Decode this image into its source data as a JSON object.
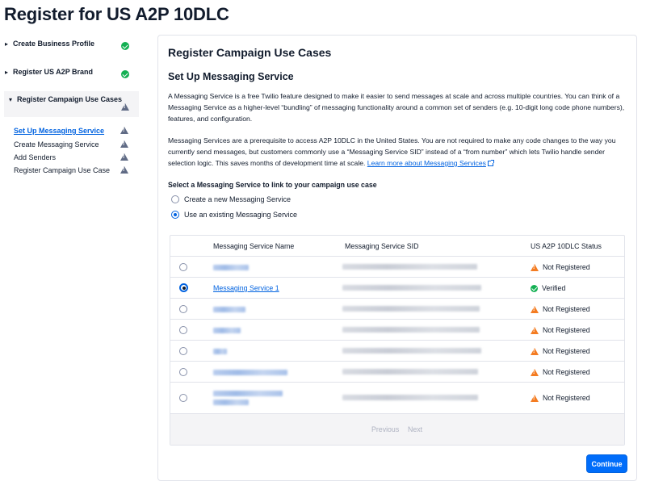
{
  "page": {
    "title": "Register for US A2P 10DLC"
  },
  "sidebar": {
    "steps": [
      {
        "label": "Create Business Profile",
        "status": "complete"
      },
      {
        "label": "Register US A2P Brand",
        "status": "complete"
      },
      {
        "label": "Register Campaign Use Cases",
        "status": "warning",
        "expanded": true
      }
    ],
    "substeps": [
      {
        "label": "Set Up Messaging Service",
        "status": "warning",
        "current": true
      },
      {
        "label": "Create Messaging Service",
        "status": "warning"
      },
      {
        "label": "Add Senders",
        "status": "warning"
      },
      {
        "label": "Register Campaign Use Case",
        "status": "warning"
      }
    ]
  },
  "main": {
    "heading": "Register Campaign Use Cases",
    "subheading": "Set Up Messaging Service",
    "paragraph1": "A Messaging Service is a free Twilio feature designed to make it easier to send messages at scale and across multiple countries. You can think of a Messaging Service as a higher-level “bundling” of messaging functionality around a common set of senders (e.g. 10-digit long code phone numbers), features, and configuration.",
    "paragraph2": "Messaging Services are a prerequisite to access A2P 10DLC in the United States. You are not required to make any code changes to the way you currently send messages, but customers commonly use a “Messaging Service SID” instead of a “from number” which lets Twilio handle sender selection logic. This saves months of development time at scale.",
    "learn_more_link": "Learn more about Messaging Services",
    "select_label": "Select a Messaging Service to link to your campaign use case",
    "options": [
      {
        "label": "Create a new Messaging Service",
        "selected": false
      },
      {
        "label": "Use an existing Messaging Service",
        "selected": true
      }
    ],
    "table": {
      "columns": [
        "Messaging Service Name",
        "Messaging Service SID",
        "US A2P 10DLC Status"
      ],
      "rows": [
        {
          "name": "",
          "selected": false,
          "status": "Not Registered",
          "status_type": "warning"
        },
        {
          "name": "Messaging Service 1",
          "selected": true,
          "status": "Verified",
          "status_type": "success"
        },
        {
          "name": "",
          "selected": false,
          "status": "Not Registered",
          "status_type": "warning"
        },
        {
          "name": "",
          "selected": false,
          "status": "Not Registered",
          "status_type": "warning"
        },
        {
          "name": "",
          "selected": false,
          "status": "Not Registered",
          "status_type": "warning"
        },
        {
          "name": "",
          "selected": false,
          "status": "Not Registered",
          "status_type": "warning"
        },
        {
          "name": "",
          "selected": false,
          "status": "Not Registered",
          "status_type": "warning"
        }
      ],
      "pagination": {
        "previous": "Previous",
        "next": "Next"
      }
    },
    "continue_label": "Continue"
  },
  "colors": {
    "accent": "#0263e0",
    "success": "#14b053",
    "warning": "#f47c22",
    "neutral_warning": "#606b85"
  }
}
